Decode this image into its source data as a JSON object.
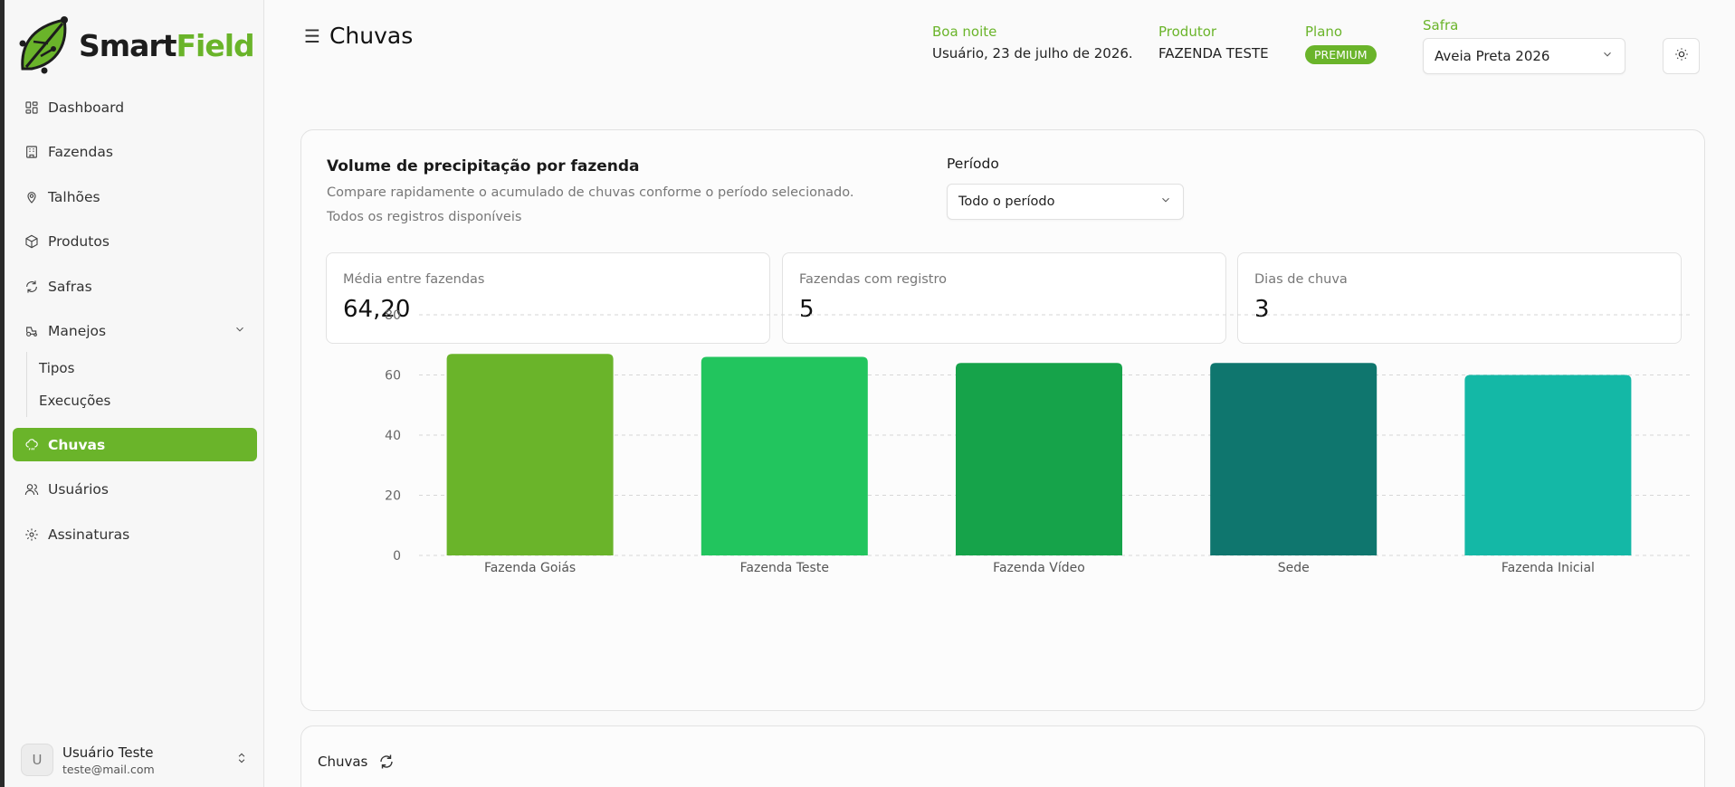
{
  "brand": {
    "name_part1": "Smart",
    "name_part2": "Field",
    "accent": "#6ab42a"
  },
  "sidebar": {
    "items": [
      {
        "label": "Dashboard",
        "icon": "dashboard-icon"
      },
      {
        "label": "Fazendas",
        "icon": "building-icon"
      },
      {
        "label": "Talhões",
        "icon": "map-pin-icon"
      },
      {
        "label": "Produtos",
        "icon": "package-icon"
      },
      {
        "label": "Safras",
        "icon": "refresh-icon"
      },
      {
        "label": "Manejos",
        "icon": "tractor-icon"
      },
      {
        "label": "Chuvas",
        "icon": "cloud-rain-icon"
      },
      {
        "label": "Usuários",
        "icon": "users-icon"
      },
      {
        "label": "Assinaturas",
        "icon": "gear-icon"
      }
    ],
    "manejos_sub": [
      "Tipos",
      "Execuções"
    ],
    "user": {
      "initial": "U",
      "name": "Usuário Teste",
      "email": "teste@mail.com"
    }
  },
  "header": {
    "title": "Chuvas",
    "greeting_label": "Boa noite",
    "greeting_value": "Usuário, 23 de julho de 2026.",
    "produtor_label": "Produtor",
    "produtor_value": "FAZENDA TESTE",
    "plano_label": "Plano",
    "plano_value": "PREMIUM",
    "safra_label": "Safra",
    "safra_value": "Aveia Preta 2026"
  },
  "card": {
    "title": "Volume de precipitação por fazenda",
    "subtitle": "Compare rapidamente o acumulado de chuvas conforme o período selecionado.",
    "subtitle2": "Todos os registros disponíveis",
    "periodo_label": "Período",
    "periodo_value": "Todo o período",
    "stats": [
      {
        "label": "Média entre fazendas",
        "value": "64,20"
      },
      {
        "label": "Fazendas com registro",
        "value": "5"
      },
      {
        "label": "Dias de chuva",
        "value": "3"
      }
    ]
  },
  "chart_data": {
    "type": "bar",
    "categories": [
      "Fazenda Goiás",
      "Fazenda Teste",
      "Fazenda Vídeo",
      "Sede",
      "Fazenda Inicial"
    ],
    "values": [
      67,
      66,
      64,
      64,
      60
    ],
    "colors": [
      "#6ab42a",
      "#22c55e",
      "#16a34a",
      "#0f766e",
      "#14b8a6"
    ],
    "yticks": [
      0,
      20,
      40,
      60,
      80
    ],
    "ylim": [
      0,
      80
    ],
    "grid": true
  },
  "card2": {
    "title": "Chuvas"
  }
}
